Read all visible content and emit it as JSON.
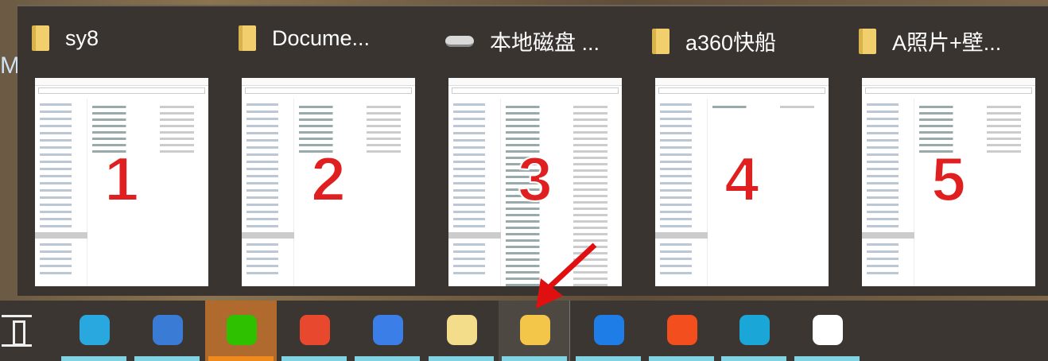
{
  "side_letter": "M",
  "windows": [
    {
      "title": "sy8",
      "icon": "folder-icon",
      "number": "1"
    },
    {
      "title": "Docume...",
      "icon": "folder-icon",
      "number": "2"
    },
    {
      "title": "本地磁盘 ...",
      "icon": "drive-icon",
      "number": "3"
    },
    {
      "title": "a360快船",
      "icon": "folder-icon",
      "number": "4"
    },
    {
      "title": "A照片+壁...",
      "icon": "folder-icon",
      "number": "5"
    }
  ],
  "taskbar": {
    "items": [
      {
        "name": "file-transfer-app",
        "color": "#29a8e0"
      },
      {
        "name": "browser-app",
        "color": "#3a7bd5"
      },
      {
        "name": "wechat",
        "color": "#2dc100",
        "active": true
      },
      {
        "name": "color-wheel-app",
        "color": "#e8492e"
      },
      {
        "name": "wps-writer",
        "color": "#3b7ee8"
      },
      {
        "name": "star-app",
        "color": "#f3dc8a"
      },
      {
        "name": "file-explorer",
        "color": "#f3c64a",
        "hover": true
      },
      {
        "name": "feishu-app",
        "color": "#1e7de6"
      },
      {
        "name": "sogou-input",
        "color": "#f24e1e"
      },
      {
        "name": "edge-browser",
        "color": "#1aa6d6"
      },
      {
        "name": "files-app",
        "color": "#ffffff"
      }
    ]
  },
  "colors": {
    "highlight": "#e02020",
    "indicator": "#7fd3e3"
  }
}
